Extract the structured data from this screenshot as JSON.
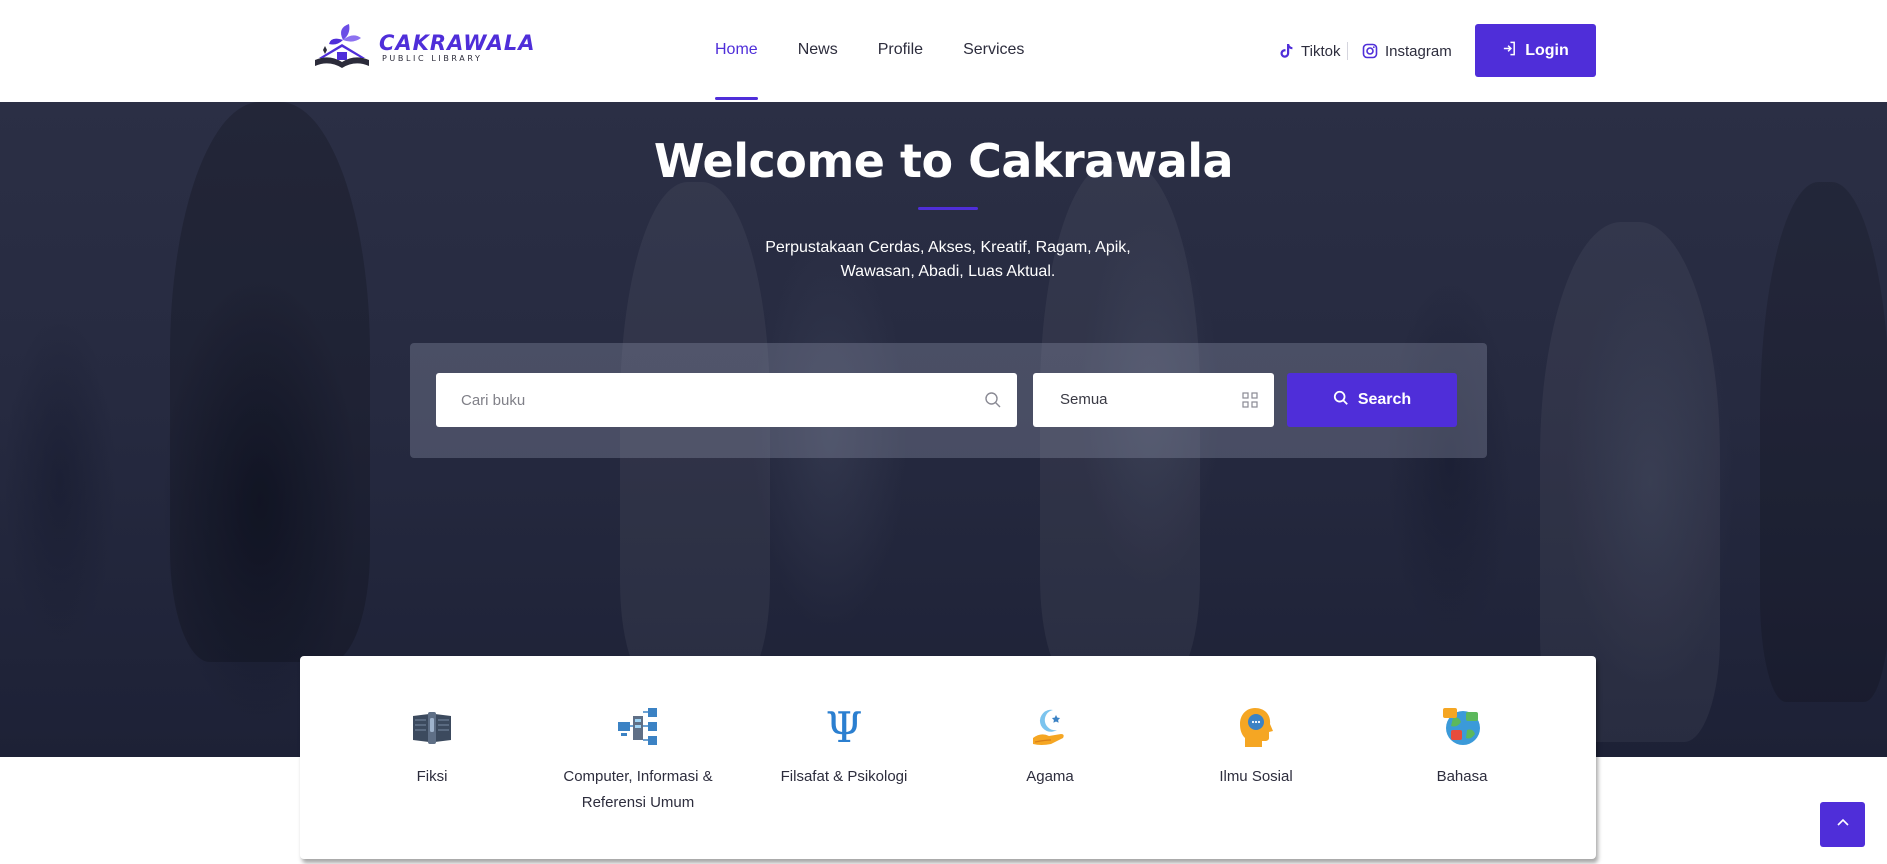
{
  "brand": {
    "name": "CAKRAWALA",
    "tagline": "PUBLIC LIBRARY",
    "color": "#4f2ed9"
  },
  "nav": {
    "items": [
      {
        "label": "Home",
        "active": true
      },
      {
        "label": "News",
        "active": false
      },
      {
        "label": "Profile",
        "active": false
      },
      {
        "label": "Services",
        "active": false
      }
    ]
  },
  "social": {
    "tiktok": {
      "label": "Tiktok",
      "icon": "tiktok-icon"
    },
    "instagram": {
      "label": "Instagram",
      "icon": "instagram-icon"
    }
  },
  "header": {
    "login_label": "Login",
    "login_icon": "login-icon"
  },
  "hero": {
    "title": "Welcome to Cakrawala",
    "subtitle": "Perpustakaan Cerdas, Akses, Kreatif, Ragam, Apik, Wawasan, Abadi, Luas Aktual."
  },
  "search": {
    "placeholder": "Cari buku",
    "category_value": "Semua",
    "button_label": "Search"
  },
  "categories": [
    {
      "label": "Fiksi",
      "icon": "book-icon"
    },
    {
      "label": "Computer, Informasi & Referensi Umum",
      "icon": "network-icon"
    },
    {
      "label": "Filsafat & Psikologi",
      "icon": "psi-icon"
    },
    {
      "label": "Agama",
      "icon": "crescent-hand-icon"
    },
    {
      "label": "Ilmu Sosial",
      "icon": "head-chat-icon"
    },
    {
      "label": "Bahasa",
      "icon": "globe-icon"
    }
  ]
}
